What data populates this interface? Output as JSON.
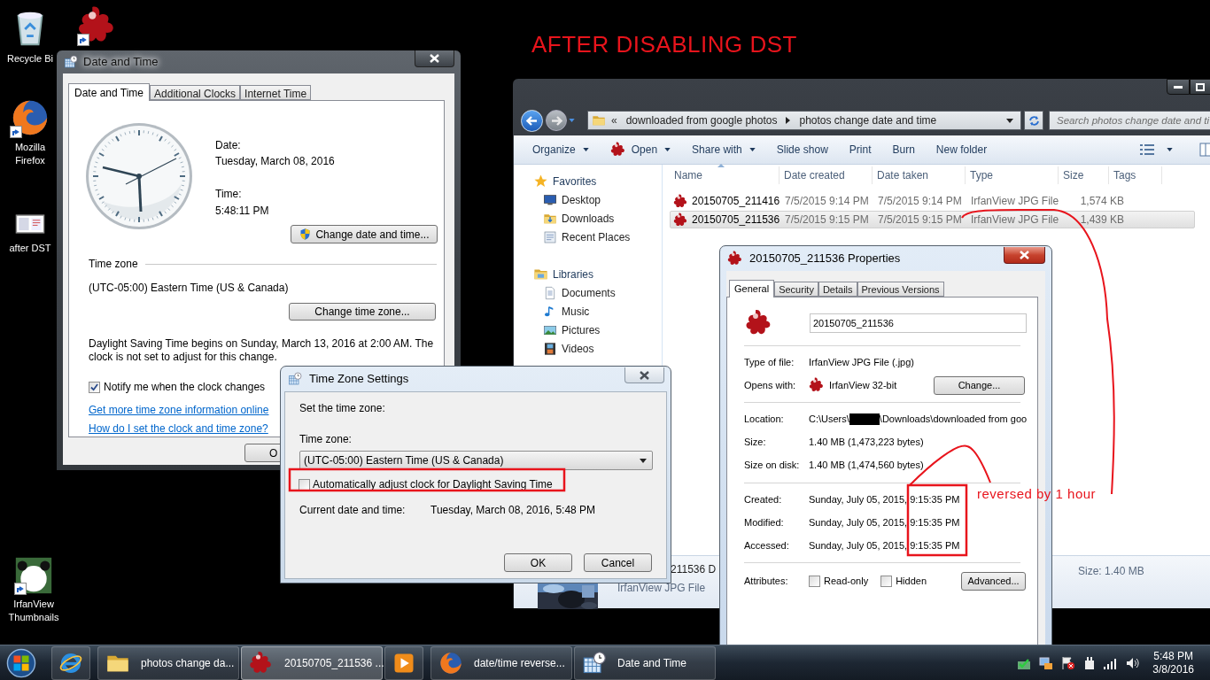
{
  "annotations": {
    "title": "AFTER DISABLING DST",
    "note": "reversed by 1 hour"
  },
  "desktop_icons": [
    {
      "kind": "recycle",
      "label": "Recycle Bi"
    },
    {
      "kind": "irfan"
    },
    {
      "kind": "firefox",
      "label": "Mozilla Firefox"
    },
    {
      "kind": "screenshot",
      "label": "after DST"
    },
    {
      "kind": "panda",
      "label": "IrfanView Thumbnails"
    }
  ],
  "explorer": {
    "overflow_mark": "«",
    "breadcrumbs": [
      "downloaded from google photos",
      "photos change date and time"
    ],
    "search": {
      "placeholder": "Search photos change date and ti"
    },
    "toolbar": [
      {
        "label": "Organize",
        "kind": "menu"
      },
      {
        "label": "Open",
        "kind": "open"
      },
      {
        "label": "Share with",
        "kind": "menu"
      },
      {
        "label": "Slide show",
        "kind": "plain"
      },
      {
        "label": "Print",
        "kind": "plain"
      },
      {
        "label": "Burn",
        "kind": "plain"
      },
      {
        "label": "New folder",
        "kind": "plain"
      }
    ],
    "nav": [
      {
        "label": "Favorites",
        "kind": "star",
        "children": [
          {
            "label": "Desktop",
            "kind": "desktop"
          },
          {
            "label": "Downloads",
            "kind": "downloads"
          },
          {
            "label": "Recent Places",
            "kind": "recent"
          }
        ]
      },
      {
        "label": "Libraries",
        "kind": "libraries",
        "children": [
          {
            "label": "Documents",
            "kind": "documents"
          },
          {
            "label": "Music",
            "kind": "music"
          },
          {
            "label": "Pictures",
            "kind": "pictures"
          },
          {
            "label": "Videos",
            "kind": "videos"
          }
        ]
      }
    ],
    "columns": [
      "Name",
      "Date created",
      "Date taken",
      "Type",
      "Size",
      "Tags"
    ],
    "rows": [
      {
        "name": "20150705_211416",
        "date_created": "7/5/2015 9:14 PM",
        "date_taken": "7/5/2015 9:14 PM",
        "type": "IrfanView JPG File",
        "size": "1,574 KB",
        "selected": false
      },
      {
        "name": "20150705_211536",
        "date_created": "7/5/2015 9:15 PM",
        "date_taken": "7/5/2015 9:15 PM",
        "type": "IrfanView JPG File",
        "size": "1,439 KB",
        "selected": true
      }
    ],
    "details_pane": {
      "name": "211536 D",
      "type": "IrfanView JPG File",
      "size": "Size: 1.40 MB"
    }
  },
  "date_time_window": {
    "title": "Date and Time",
    "tabs": [
      {
        "label": "Date and Time",
        "selected": true
      },
      {
        "label": "Additional Clocks",
        "selected": false
      },
      {
        "label": "Internet Time",
        "selected": false
      }
    ],
    "date_label": "Date:",
    "date": "Tuesday, March 08, 2016",
    "time_label": "Time:",
    "time": "5:48:11 PM",
    "change_date_button": "Change date and time...",
    "time_zone_heading": "Time zone",
    "time_zone": "(UTC-05:00) Eastern Time (US & Canada)",
    "change_zone_button": "Change time zone...",
    "dst_note": "Daylight Saving Time begins on Sunday, March 13, 2016 at 2:00 AM. The clock is not set to adjust for this change.",
    "notify": {
      "label": "Notify me when the clock changes",
      "checked": true
    },
    "links": [
      "Get more time zone information online",
      "How do I set the clock and time zone?"
    ],
    "ok_button": "O"
  },
  "properties_window": {
    "title": "20150705_211536 Properties",
    "tabs": [
      {
        "label": "General",
        "selected": true
      },
      {
        "label": "Security",
        "selected": false
      },
      {
        "label": "Details",
        "selected": false
      },
      {
        "label": "Previous Versions",
        "selected": false
      }
    ],
    "file_name": "20150705_211536",
    "sections": [
      [
        {
          "kind": "text",
          "label": "Type of file:",
          "value": "IrfanView JPG File (.jpg)"
        },
        {
          "kind": "app",
          "label": "Opens with:",
          "value": "IrfanView 32-bit",
          "button": "Change..."
        }
      ],
      [
        {
          "kind": "redacted",
          "label": "Location:",
          "value_before": "C:\\Users\\",
          "value_after": "\\Downloads\\downloaded from goo"
        },
        {
          "kind": "text",
          "label": "Size:",
          "value": "1.40 MB (1,473,223 bytes)"
        },
        {
          "kind": "text",
          "label": "Size on disk:",
          "value": "1.40 MB (1,474,560 bytes)"
        }
      ],
      [
        {
          "kind": "text",
          "label": "Created:",
          "value": "Sunday, July 05, 2015, 9:15:35 PM"
        },
        {
          "kind": "text",
          "label": "Modified:",
          "value": "Sunday, July 05, 2015, 9:15:35 PM"
        },
        {
          "kind": "text",
          "label": "Accessed:",
          "value": "Sunday, July 05, 2015, 9:15:35 PM"
        }
      ],
      [
        {
          "kind": "attributes",
          "label": "Attributes:",
          "options": [
            {
              "label": "Read-only",
              "checked": false
            },
            {
              "label": "Hidden",
              "checked": false
            }
          ],
          "button": "Advanced..."
        }
      ]
    ]
  },
  "time_zone_window": {
    "title": "Time Zone Settings",
    "prompt": "Set the time zone:",
    "zone_label": "Time zone:",
    "zone_value": "(UTC-05:00) Eastern Time (US & Canada)",
    "dst_checkbox": {
      "label": "Automatically adjust clock for Daylight Saving Time",
      "checked": false
    },
    "current_label": "Current date and time:",
    "current_value": "Tuesday, March 08, 2016, 5:48 PM",
    "buttons": [
      "OK",
      "Cancel"
    ]
  },
  "taskbar": {
    "items": [
      {
        "kind": "ie",
        "selected": false
      },
      {
        "kind": "folder",
        "label": "photos change da...",
        "selected": false
      },
      {
        "kind": "irfan",
        "label": "20150705_211536 ...",
        "selected": true
      },
      {
        "kind": "media",
        "selected": false
      },
      {
        "kind": "firefox",
        "label": "date/time reverse...",
        "selected": false
      },
      {
        "kind": "datetime",
        "label": "Date and Time",
        "selected": false
      }
    ],
    "clock": {
      "time": "5:48 PM",
      "date": "3/8/2016"
    }
  }
}
